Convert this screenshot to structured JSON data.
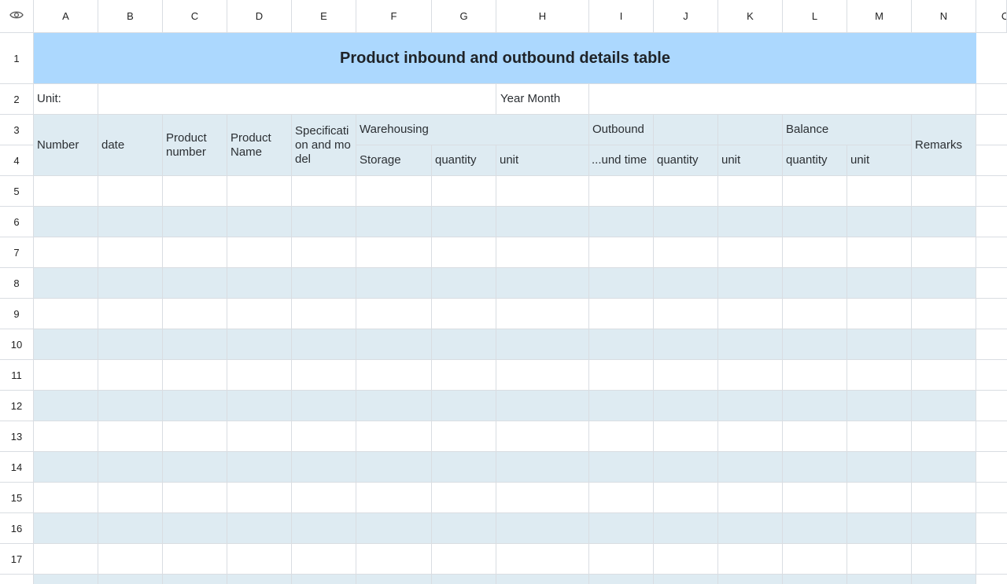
{
  "columns": [
    "A",
    "B",
    "C",
    "D",
    "E",
    "F",
    "G",
    "H",
    "I",
    "J",
    "K",
    "L",
    "M",
    "N",
    "O"
  ],
  "rows": [
    "1",
    "2",
    "3",
    "4",
    "5",
    "6",
    "7",
    "8",
    "9",
    "10",
    "11",
    "12",
    "13",
    "14",
    "15",
    "16",
    "17"
  ],
  "corner_icon": "eye-icon",
  "title": "Product inbound and outbound details table",
  "row2": {
    "unit_label": "Unit:",
    "year_month_label": "Year Month"
  },
  "headers": {
    "number": "Number",
    "date": "date",
    "product_number": "Product number",
    "product_name": "Product Name",
    "spec": "Specification and model",
    "warehousing": "Warehousing",
    "outbound": "Outbound",
    "balance": "Balance",
    "remarks": "Remarks",
    "storage": "Storage",
    "quantity_1": "quantity",
    "unit_1": "unit",
    "outbound_time": "...und time",
    "quantity_2": "quantity",
    "unit_2": "unit",
    "quantity_3": "quantity",
    "unit_3": "unit"
  },
  "colors": {
    "title_bg": "#acd8fe",
    "header_bg": "#deebf2",
    "band_bg": "#deebf2",
    "grid": "#d9dde2"
  }
}
